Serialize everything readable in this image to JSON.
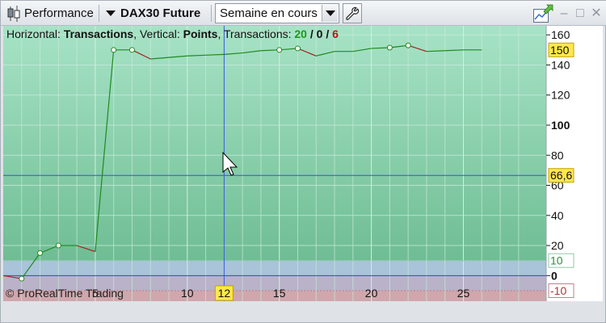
{
  "toolbar": {
    "performance_label": "Performance",
    "instrument_label": "DAX30 Future",
    "period_value": "Semaine en cours"
  },
  "header": {
    "horizontal_label": "Horizontal:",
    "horizontal_value": "Transactions",
    "vertical_label": ", Vertical:",
    "vertical_value": "Points",
    "transactions_label": ", Transactions:",
    "wins": "20",
    "sep1": " / ",
    "neutral": "0",
    "sep2": " / ",
    "losses": "6"
  },
  "copyright": "© ProRealTime Trading",
  "chart_data": {
    "type": "line",
    "xlim": [
      0,
      29.5
    ],
    "ylim": [
      -17,
      166
    ],
    "y_ticks": [
      160,
      140,
      120,
      100,
      80,
      60,
      40,
      20,
      0
    ],
    "y_bold_ticks": [
      100,
      0
    ],
    "x_ticks": [
      5,
      10,
      15,
      20,
      25
    ],
    "upper_band_label": "10",
    "lower_band_label": "-10",
    "upper_band": 10,
    "lower_band": -10,
    "last_value_label": "150",
    "last_value": 150,
    "cursor_y_label": "66,6",
    "cursor_y": 66.6,
    "cursor_x_label": "12",
    "cursor_x": 12,
    "series": [
      {
        "x": [
          0,
          1,
          2,
          3,
          4,
          5,
          6,
          7,
          8,
          9,
          10,
          11,
          12,
          13,
          14,
          15,
          16,
          17,
          18,
          19,
          20,
          21,
          22,
          23,
          24,
          25,
          26
        ],
        "y": [
          0,
          -2,
          15,
          20,
          20,
          16,
          150,
          150,
          144,
          145,
          146,
          146.5,
          147,
          148,
          149.5,
          150,
          151,
          146,
          149,
          149,
          151,
          151.5,
          153,
          149,
          149.5,
          150,
          150
        ],
        "markers": [
          1,
          2,
          3,
          6,
          7,
          15,
          16,
          21,
          22
        ]
      }
    ],
    "colors": {
      "win": "#1f8a1f",
      "loss": "#a32020",
      "crosshair": "#3355dd",
      "bg_top": "#a7e3c6",
      "bg_bottom": "#6fbd94"
    }
  }
}
